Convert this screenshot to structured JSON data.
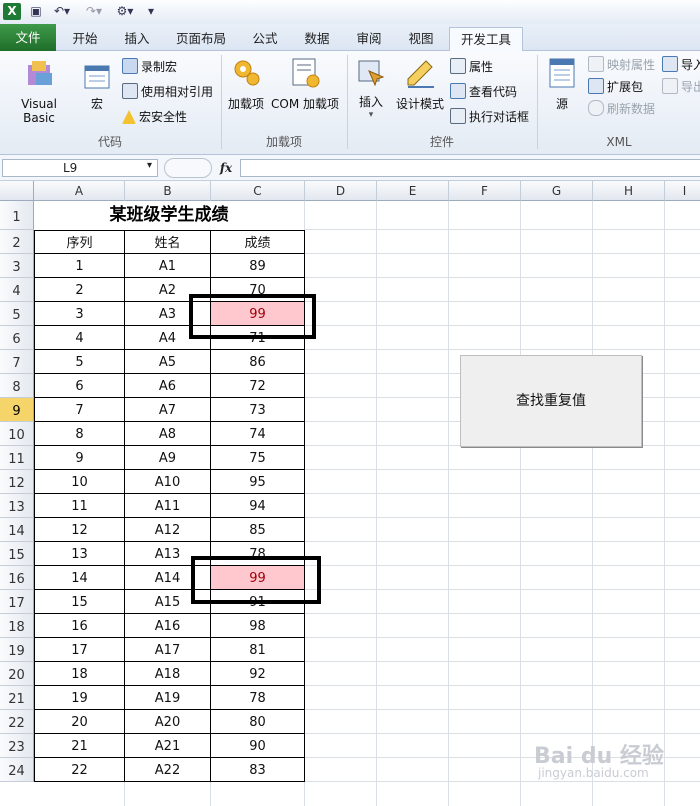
{
  "qat": {
    "app_icon": "excel-icon",
    "save_icon": "save-icon",
    "undo_icon": "undo-icon",
    "redo_icon": "redo-icon",
    "custom_icon": "customize-icon"
  },
  "tabs": [
    "文件",
    "开始",
    "插入",
    "页面布局",
    "公式",
    "数据",
    "审阅",
    "视图",
    "开发工具"
  ],
  "ribbon": {
    "code": {
      "group_label": "代码",
      "visual_basic": "Visual Basic",
      "macros": "宏",
      "record_macro": "录制宏",
      "relative_ref": "使用相对引用",
      "macro_security": "宏安全性"
    },
    "addins": {
      "group_label": "加载项",
      "addins": "加载项",
      "com_addins": "COM 加载项"
    },
    "controls": {
      "group_label": "控件",
      "insert": "插入",
      "design_mode": "设计模式",
      "properties": "属性",
      "view_code": "查看代码",
      "run_dialog": "执行对话框"
    },
    "xml": {
      "group_label": "XML",
      "source": "源",
      "map_props": "映射属性",
      "expansion": "扩展包",
      "refresh": "刷新数据",
      "import": "导入",
      "export": "导出"
    }
  },
  "formula_bar": {
    "name_box": "L9",
    "fx": "fx",
    "formula": ""
  },
  "columns": [
    "A",
    "B",
    "C",
    "D",
    "E",
    "F",
    "G",
    "H",
    "I"
  ],
  "rows": [
    "1",
    "2",
    "3",
    "4",
    "5",
    "6",
    "7",
    "8",
    "9",
    "10",
    "11",
    "12",
    "13",
    "14",
    "15",
    "16",
    "17",
    "18",
    "19",
    "20",
    "21",
    "22",
    "23",
    "24"
  ],
  "selected_row": "9",
  "sheet": {
    "title": "某班级学生成绩",
    "headers": [
      "序列",
      "姓名",
      "成绩"
    ],
    "data": [
      [
        "1",
        "A1",
        "89"
      ],
      [
        "2",
        "A2",
        "70"
      ],
      [
        "3",
        "A3",
        "99"
      ],
      [
        "4",
        "A4",
        "71"
      ],
      [
        "5",
        "A5",
        "86"
      ],
      [
        "6",
        "A6",
        "72"
      ],
      [
        "7",
        "A7",
        "73"
      ],
      [
        "8",
        "A8",
        "74"
      ],
      [
        "9",
        "A9",
        "75"
      ],
      [
        "10",
        "A10",
        "95"
      ],
      [
        "11",
        "A11",
        "94"
      ],
      [
        "12",
        "A12",
        "85"
      ],
      [
        "13",
        "A13",
        "78"
      ],
      [
        "14",
        "A14",
        "99"
      ],
      [
        "15",
        "A15",
        "91"
      ],
      [
        "16",
        "A16",
        "98"
      ],
      [
        "17",
        "A17",
        "81"
      ],
      [
        "18",
        "A18",
        "92"
      ],
      [
        "19",
        "A19",
        "78"
      ],
      [
        "20",
        "A20",
        "80"
      ],
      [
        "21",
        "A21",
        "90"
      ],
      [
        "22",
        "A22",
        "83"
      ]
    ],
    "highlighted_rows": [
      3,
      14
    ]
  },
  "button": {
    "label": "查找重复值"
  },
  "watermark": {
    "brand": "Bai du 经验",
    "url": "jingyan.baidu.com"
  },
  "colors": {
    "highlight_fill": "#ffc7ce",
    "highlight_text": "#9c0006",
    "file_tab": "#2a7f35",
    "selected_header": "#f5d46a"
  }
}
